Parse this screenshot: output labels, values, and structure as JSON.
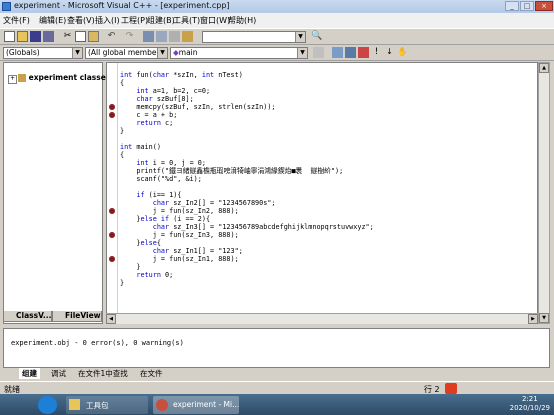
{
  "window": {
    "title": "experiment - Microsoft Visual C++ - [experiment.cpp]",
    "controls": [
      "_",
      "□",
      "×"
    ]
  },
  "menu": {
    "items": [
      "文件(F)",
      "编辑(E)",
      "查看(V)",
      "插入(I)",
      "工程(P)",
      "组建(B)",
      "工具(T)",
      "窗口(W)",
      "帮助(H)"
    ]
  },
  "toolbar": {
    "find_combo_value": "",
    "class_combo": "(Globals)",
    "members_combo": "(All global members",
    "function_combo": "main"
  },
  "workspace": {
    "tree_root": "experiment classes",
    "tabs": [
      "ClassV...",
      "FileView"
    ]
  },
  "editor": {
    "lines": [
      {
        "tokens": [
          [
            "int",
            "kw"
          ],
          [
            " fun(",
            ""
          ],
          [
            "char",
            "kw"
          ],
          [
            " *szIn, ",
            ""
          ],
          [
            "int",
            "kw"
          ],
          [
            " nTest)",
            ""
          ]
        ],
        "bp": false
      },
      {
        "tokens": [
          [
            "{",
            ""
          ]
        ],
        "bp": false
      },
      {
        "tokens": [
          [
            "    ",
            ""
          ],
          [
            "int",
            "kw"
          ],
          [
            " a=1, b=2, c=0;",
            ""
          ]
        ],
        "bp": false
      },
      {
        "tokens": [
          [
            "    ",
            ""
          ],
          [
            "char",
            "kw"
          ],
          [
            " szBuf[8];",
            ""
          ]
        ],
        "bp": false
      },
      {
        "tokens": [
          [
            "    memcpy(szBuf, szIn, strlen(szIn));",
            ""
          ]
        ],
        "bp": true
      },
      {
        "tokens": [
          [
            "    c = a + b;",
            ""
          ]
        ],
        "bp": true
      },
      {
        "tokens": [
          [
            "    ",
            ""
          ],
          [
            "return",
            "kw"
          ],
          [
            " c;",
            ""
          ]
        ],
        "bp": false
      },
      {
        "tokens": [
          [
            "}",
            ""
          ]
        ],
        "bp": false
      },
      {
        "tokens": [
          [
            "",
            ""
          ]
        ],
        "bp": false
      },
      {
        "tokens": [
          [
            "int",
            "kw"
          ],
          [
            " main()",
            ""
          ]
        ],
        "bp": false
      },
      {
        "tokens": [
          [
            "{",
            ""
          ]
        ],
        "bp": false
      },
      {
        "tokens": [
          [
            "    ",
            ""
          ],
          [
            "int",
            "kw"
          ],
          [
            " i = 0, j = 0;",
            ""
          ]
        ],
        "bp": false
      },
      {
        "tokens": [
          [
            "    printf(\"鐵ヨ緒鐩鑫檐瓶瑕嗙湇犄岫寧涓鴻緣鍥炲■褁  鐩樹紒\");",
            ""
          ]
        ],
        "bp": false
      },
      {
        "tokens": [
          [
            "    scanf(\"%d\", &i);",
            ""
          ]
        ],
        "bp": false
      },
      {
        "tokens": [
          [
            "",
            ""
          ]
        ],
        "bp": false
      },
      {
        "tokens": [
          [
            "    ",
            ""
          ],
          [
            "if",
            "kw"
          ],
          [
            " (i== 1){",
            ""
          ]
        ],
        "bp": false
      },
      {
        "tokens": [
          [
            "        ",
            ""
          ],
          [
            "char",
            "kw"
          ],
          [
            " sz_In2[] = \"1234567890s\";",
            ""
          ]
        ],
        "bp": false
      },
      {
        "tokens": [
          [
            "        j = fun(sz_In2, 888);",
            ""
          ]
        ],
        "bp": true
      },
      {
        "tokens": [
          [
            "    }",
            ""
          ],
          [
            "else if",
            "kw"
          ],
          [
            " (i == 2){",
            ""
          ]
        ],
        "bp": false
      },
      {
        "tokens": [
          [
            "        ",
            ""
          ],
          [
            "char",
            "kw"
          ],
          [
            " sz_In3[] = \"123456789abcdefghijklmnopqrstuvwxyz\";",
            ""
          ]
        ],
        "bp": false
      },
      {
        "tokens": [
          [
            "        j = fun(sz_In3, 888);",
            ""
          ]
        ],
        "bp": true
      },
      {
        "tokens": [
          [
            "    }",
            ""
          ],
          [
            "else",
            "kw"
          ],
          [
            "{",
            ""
          ]
        ],
        "bp": false
      },
      {
        "tokens": [
          [
            "        ",
            ""
          ],
          [
            "char",
            "kw"
          ],
          [
            " sz_In1[] = \"123\";",
            ""
          ]
        ],
        "bp": false
      },
      {
        "tokens": [
          [
            "        j = fun(sz_In1, 888);",
            ""
          ]
        ],
        "bp": true
      },
      {
        "tokens": [
          [
            "    }",
            ""
          ]
        ],
        "bp": false
      },
      {
        "tokens": [
          [
            "    ",
            ""
          ],
          [
            "return",
            "kw"
          ],
          [
            " 0;",
            ""
          ]
        ],
        "bp": false
      },
      {
        "tokens": [
          [
            "}",
            ""
          ]
        ],
        "bp": false
      }
    ]
  },
  "output": {
    "text": "experiment.obj - 0 error(s), 0 warning(s)",
    "tabs": [
      "组建",
      "调试",
      "在文件1中查找",
      "在文件"
    ]
  },
  "status": {
    "text": "就绪",
    "position": "行 2"
  },
  "taskbar": {
    "items": [
      "工具包",
      "experiment - Mi..."
    ],
    "time": "2:21",
    "date": "2020/10/29"
  },
  "colors": {
    "keyword": "#0000cc",
    "breakpoint": "#8b1a1a",
    "titlebar": "#b3c9e6",
    "taskbar": "#2d4b67"
  }
}
